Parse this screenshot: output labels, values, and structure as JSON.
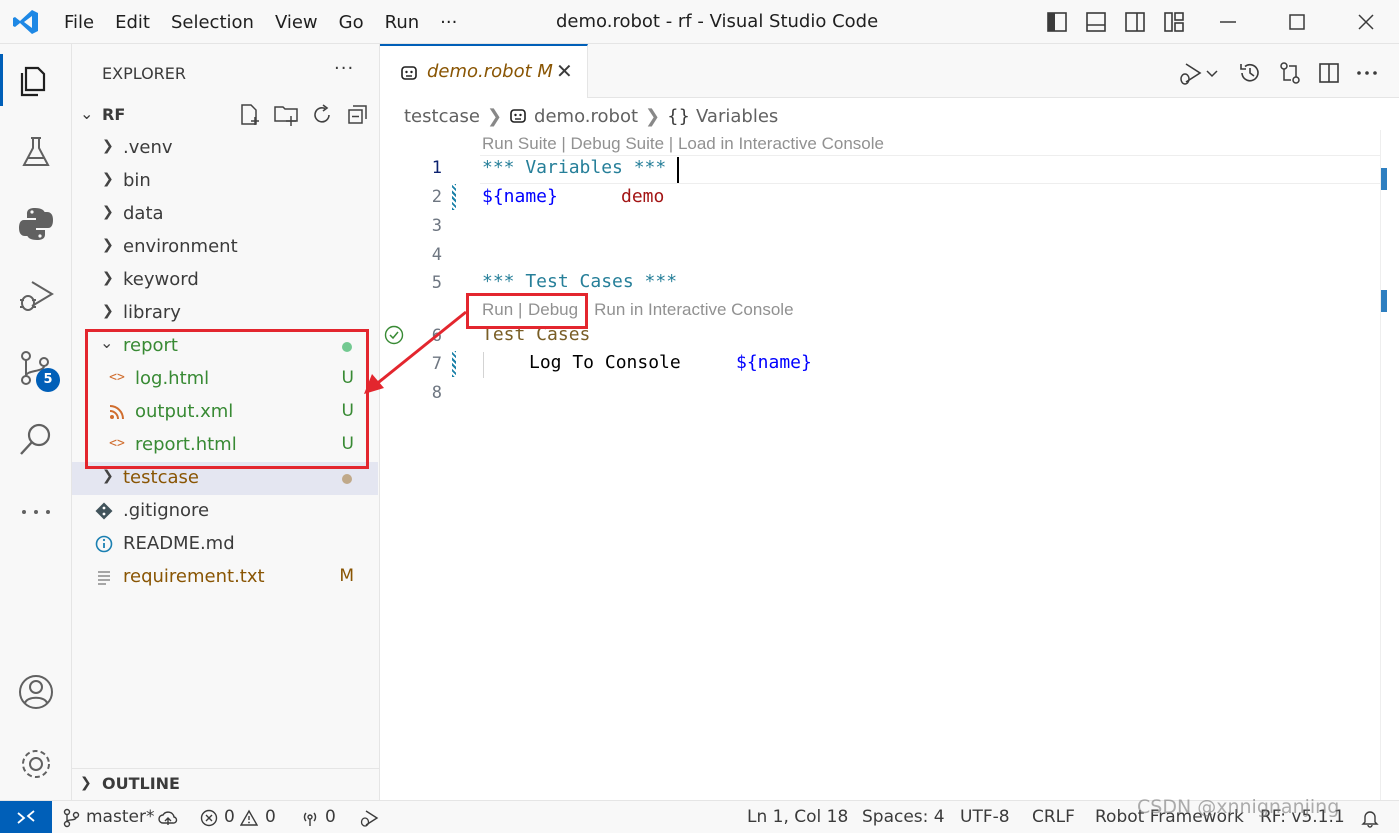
{
  "titlebar": {
    "menu": [
      "File",
      "Edit",
      "Selection",
      "View",
      "Go",
      "Run",
      "···"
    ],
    "title": "demo.robot - rf - Visual Studio Code"
  },
  "activitybar": {
    "items": [
      "explorer-icon",
      "testing-icon",
      "python-icon",
      "run-debug-icon",
      "source-control-icon",
      "search-icon",
      "more-icon"
    ],
    "source_control_badge": "5",
    "bottom": [
      "account-icon",
      "manage-gear-icon"
    ]
  },
  "explorer": {
    "title": "EXPLORER",
    "more": "···",
    "root": "RF",
    "outline": "OUTLINE",
    "tree": [
      {
        "name": ".venv",
        "type": "folder",
        "expanded": false
      },
      {
        "name": "bin",
        "type": "folder",
        "expanded": false
      },
      {
        "name": "data",
        "type": "folder",
        "expanded": false
      },
      {
        "name": "environment",
        "type": "folder",
        "expanded": false
      },
      {
        "name": "keyword",
        "type": "folder",
        "expanded": false
      },
      {
        "name": "library",
        "type": "folder",
        "expanded": false
      },
      {
        "name": "report",
        "type": "folder",
        "expanded": true,
        "status_color": "#73c991"
      },
      {
        "name": "log.html",
        "type": "html",
        "decoration": "U"
      },
      {
        "name": "output.xml",
        "type": "xml",
        "decoration": "U"
      },
      {
        "name": "report.html",
        "type": "html",
        "decoration": "U"
      },
      {
        "name": "testcase",
        "type": "folder",
        "expanded": false,
        "selected": true,
        "status_color": "#c0a98a"
      },
      {
        "name": ".gitignore",
        "type": "git"
      },
      {
        "name": "README.md",
        "type": "info"
      },
      {
        "name": "requirement.txt",
        "type": "text",
        "decoration": "M"
      }
    ]
  },
  "editor": {
    "tab": {
      "label": "demo.robot",
      "badge": "M",
      "close": "✕"
    },
    "breadcrumb": {
      "folder": "testcase",
      "file": "demo.robot",
      "symbol": "Variables",
      "symbol_prefix": "{}"
    },
    "codelens_top": "Run Suite | Debug Suite | Load in Interactive Console",
    "codelens_test_run": "Run",
    "codelens_test_sep": "|",
    "codelens_test_debug": "Debug",
    "codelens_test_console": "| Run in Interactive Console",
    "line_numbers": [
      "1",
      "2",
      "3",
      "4",
      "5",
      "6",
      "7",
      "8"
    ],
    "lines": {
      "l1": "*** Variables ***",
      "l2_var": "${name}",
      "l2_val": "demo",
      "l5": "*** Test Cases ***",
      "l6": "Test Cases",
      "l7_kw": "Log To Console",
      "l7_arg": "${name}"
    }
  },
  "statusbar": {
    "branch": "master*",
    "errors": "0",
    "warnings": "0",
    "ports": "0",
    "cursor": "Ln 1, Col 18",
    "spaces": "Spaces: 4",
    "encoding": "UTF-8",
    "eol": "CRLF",
    "language": "Robot Framework",
    "rf_version": "RF: v5.1.1"
  },
  "watermark": "CSDN @xnnignanjing",
  "colors": {
    "accent": "#005fb8",
    "untracked": "#388a34",
    "modified": "#895503",
    "annotation_red": "#e3262e"
  }
}
